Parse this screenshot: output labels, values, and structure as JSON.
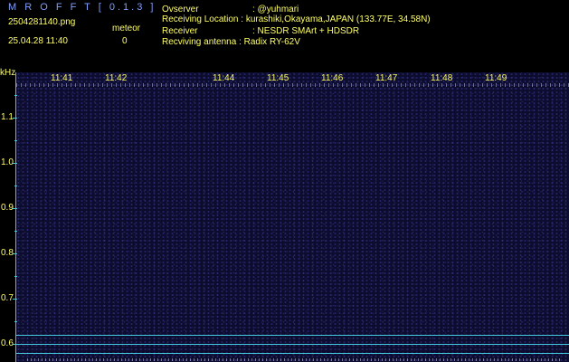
{
  "header": {
    "app_title": "M R O F F T [ 0.1.3 ]",
    "file_name": "2504281140.png",
    "datetime": "25.04.28 11:40",
    "meteor_label": "meteor",
    "meteor_count": "0"
  },
  "station": {
    "observer_key": "Ovserver",
    "observer_value": ": @yuhmari",
    "location_key": "Receiving Location",
    "location_value": ": kurashiki,Okayama,JAPAN (133.77E, 34.58N)",
    "receiver_key": "Receiver",
    "receiver_value": ": NESDR SMArt + HDSDR",
    "antenna_key": "Recviving antenna",
    "antenna_value": ": Radix RY-62V"
  },
  "axis": {
    "y_unit": "kHz",
    "y_labels": [
      "1.1",
      "1.0",
      "0.9",
      "0.8",
      "0.7",
      "0.6"
    ],
    "x_labels": [
      "11:41",
      "11:42",
      "11:44",
      "11:45",
      "11:46",
      "11:47",
      "11:48",
      "11:49"
    ]
  },
  "colors": {
    "text": "#ffff66",
    "title": "#7f9fff",
    "axis": "#44c6dd",
    "background": "#0c0c2e"
  }
}
